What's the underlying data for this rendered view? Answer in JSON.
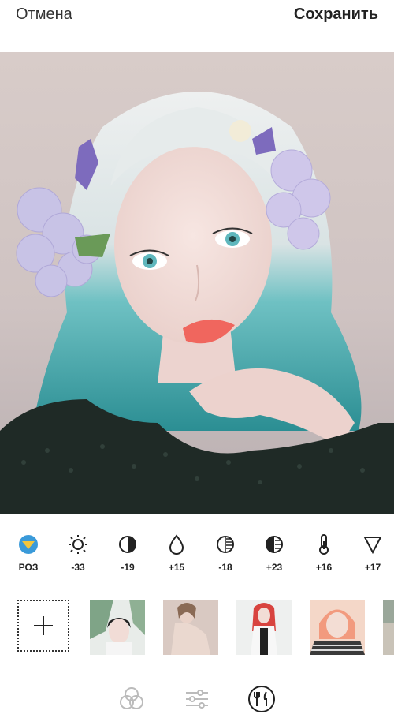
{
  "header": {
    "cancel_label": "Отмена",
    "save_label": "Сохранить"
  },
  "photo": {
    "description_icon": "portrait-photo"
  },
  "adjustments": [
    {
      "icon": "filter-preset-icon",
      "value": "РОЗ"
    },
    {
      "icon": "brightness-icon",
      "value": "-33"
    },
    {
      "icon": "contrast-icon",
      "value": "-19"
    },
    {
      "icon": "saturation-drop-icon",
      "value": "+15"
    },
    {
      "icon": "shadows-icon",
      "value": "-18"
    },
    {
      "icon": "highlights-icon",
      "value": "+23"
    },
    {
      "icon": "temperature-icon",
      "value": "+16"
    },
    {
      "icon": "fade-triangle-icon",
      "value": "+17"
    }
  ],
  "presets": {
    "add_icon": "plus-icon",
    "thumbnails": [
      "thumb-1",
      "thumb-2",
      "thumb-3",
      "thumb-4",
      "thumb-5"
    ]
  },
  "bottom_nav": [
    "filters-tab-icon",
    "adjust-tab-icon",
    "recipes-tab-icon"
  ],
  "colors": {
    "accent_blue": "#3a9ad9",
    "accent_yellow": "#f2c53d",
    "text": "#222222"
  }
}
